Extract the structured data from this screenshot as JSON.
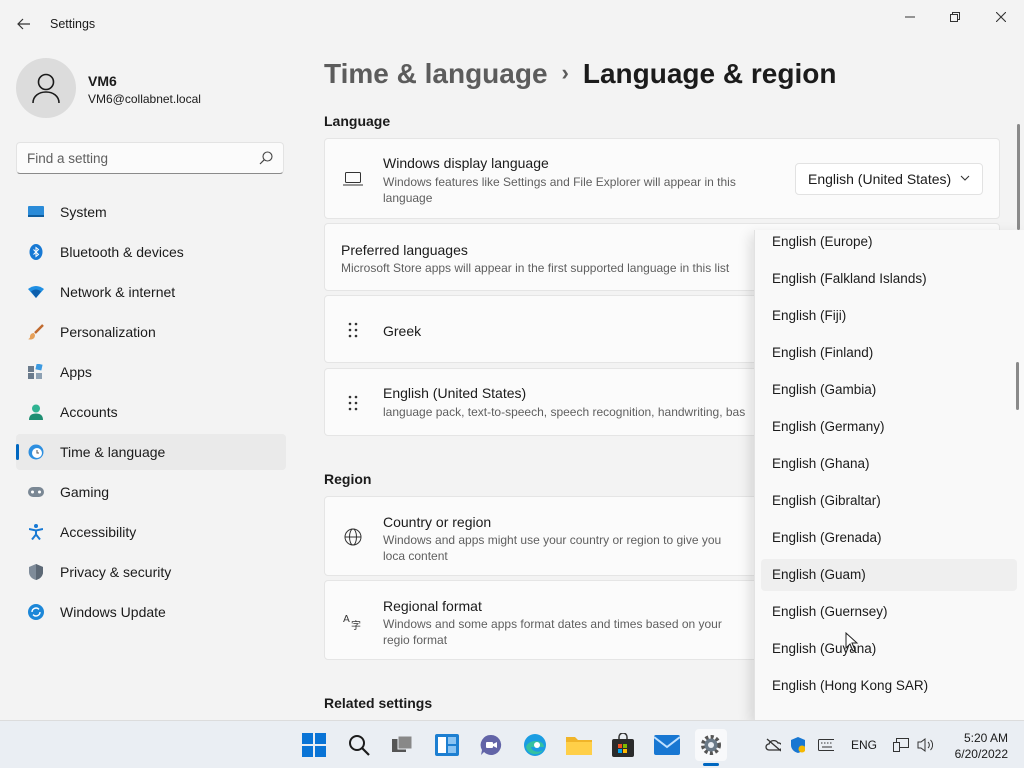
{
  "window": {
    "title": "Settings"
  },
  "profile": {
    "name": "VM6",
    "email": "VM6@collabnet.local"
  },
  "search": {
    "placeholder": "Find a setting"
  },
  "sidebar": {
    "items": [
      {
        "label": "System",
        "icon": "system-icon"
      },
      {
        "label": "Bluetooth & devices",
        "icon": "bluetooth-icon"
      },
      {
        "label": "Network & internet",
        "icon": "wifi-icon"
      },
      {
        "label": "Personalization",
        "icon": "brush-icon"
      },
      {
        "label": "Apps",
        "icon": "apps-icon"
      },
      {
        "label": "Accounts",
        "icon": "accounts-icon"
      },
      {
        "label": "Time & language",
        "icon": "time-language-icon",
        "active": true
      },
      {
        "label": "Gaming",
        "icon": "gaming-icon"
      },
      {
        "label": "Accessibility",
        "icon": "accessibility-icon"
      },
      {
        "label": "Privacy & security",
        "icon": "shield-icon"
      },
      {
        "label": "Windows Update",
        "icon": "update-icon"
      }
    ]
  },
  "breadcrumb": {
    "parent": "Time & language",
    "separator": "›",
    "current": "Language & region"
  },
  "language_section": {
    "heading": "Language",
    "display_language": {
      "title": "Windows display language",
      "desc": "Windows features like Settings and File Explorer will appear in this language",
      "selected": "English (United States)"
    },
    "preferred": {
      "title": "Preferred languages",
      "desc": "Microsoft Store apps will appear in the first supported language in this list"
    },
    "languages": [
      {
        "name": "Greek",
        "desc": ""
      },
      {
        "name": "English (United States)",
        "desc": "language pack, text-to-speech, speech recognition, handwriting, bas"
      }
    ]
  },
  "region_section": {
    "heading": "Region",
    "country": {
      "title": "Country or region",
      "desc": "Windows and apps might use your country or region to give you loca content"
    },
    "format": {
      "title": "Regional format",
      "desc": "Windows and some apps format dates and times based on your regio format"
    }
  },
  "related": {
    "heading": "Related settings"
  },
  "dropdown": {
    "items": [
      "English (Europe)",
      "English (Falkland Islands)",
      "English (Fiji)",
      "English (Finland)",
      "English (Gambia)",
      "English (Germany)",
      "English (Ghana)",
      "English (Gibraltar)",
      "English (Grenada)",
      "English (Guam)",
      "English (Guernsey)",
      "English (Guyana)",
      "English (Hong Kong SAR)"
    ],
    "hovered_index": 9
  },
  "taskbar": {
    "lang": "ENG",
    "time": "5:20 AM",
    "date": "6/20/2022",
    "accent": "#0067c0"
  }
}
